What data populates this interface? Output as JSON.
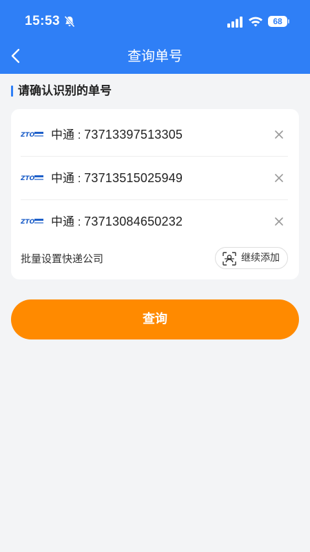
{
  "status_bar": {
    "time": "15:53",
    "battery": "68"
  },
  "nav": {
    "title": "查询单号"
  },
  "section": {
    "title": "请确认识别的单号"
  },
  "parcels": [
    {
      "company": "中通",
      "number": "73713397513305"
    },
    {
      "company": "中通",
      "number": "73713515025949"
    },
    {
      "company": "中通",
      "number": "73713084650232"
    }
  ],
  "batch": {
    "label": "批量设置快递公司",
    "add_label": "继续添加"
  },
  "query_button": {
    "label": "查询"
  },
  "colors": {
    "primary": "#2f7ff6",
    "accent": "#ff8a00",
    "logo": "#1d5fc9"
  }
}
